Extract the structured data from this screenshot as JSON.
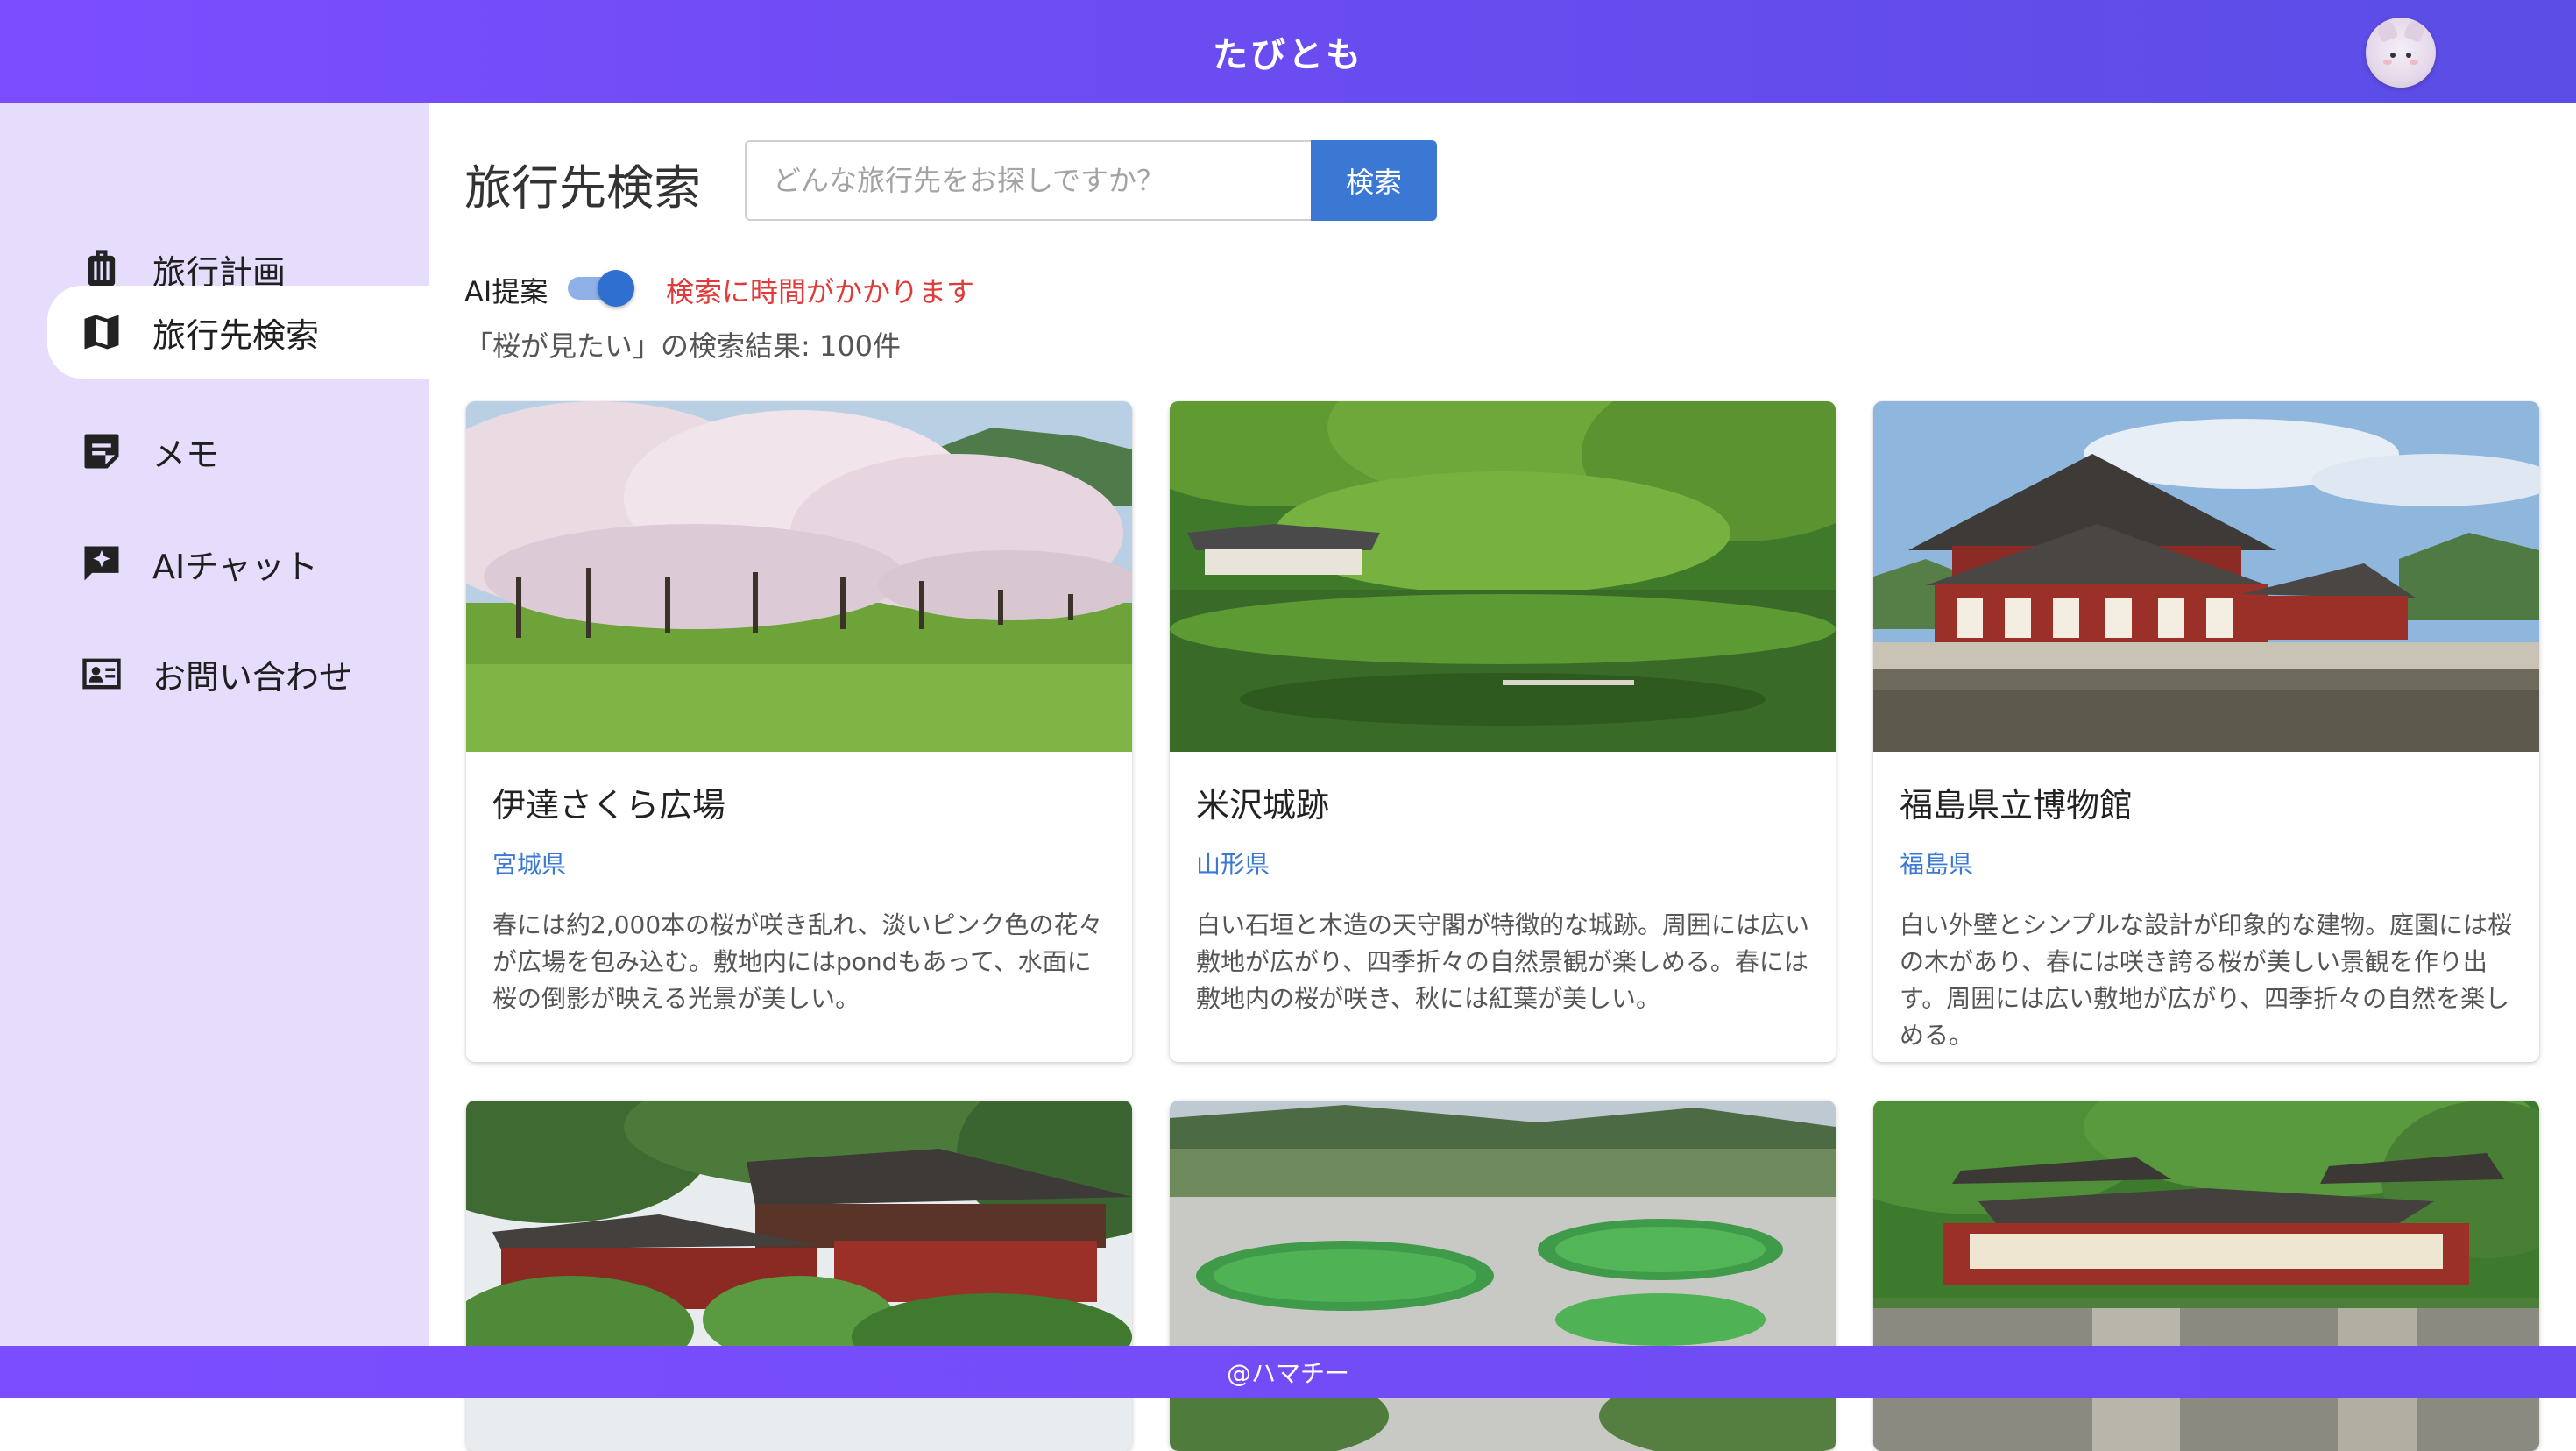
{
  "header": {
    "title": "たびとも"
  },
  "sidebar": {
    "items": [
      {
        "label": "旅行計画",
        "icon": "suitcase-icon"
      },
      {
        "label": "旅行先検索",
        "icon": "map-icon"
      },
      {
        "label": "メモ",
        "icon": "note-icon"
      },
      {
        "label": "AIチャット",
        "icon": "ai-chat-icon"
      },
      {
        "label": "お問い合わせ",
        "icon": "contact-card-icon"
      }
    ]
  },
  "search": {
    "title": "旅行先検索",
    "placeholder": "どんな旅行先をお探しですか？",
    "value": "",
    "button_label": "検索",
    "ai_label": "AI提案",
    "ai_enabled": true,
    "warning": "検索に時間がかかります",
    "result_count": "「桜が見たい」の検索結果: 100件"
  },
  "results": [
    {
      "name": "伊達さくら広場",
      "prefecture": "宮城県",
      "description": "春には約2,000本の桜が咲き乱れ、淡いピンク色の花々が広場を包み込む。敷地内にはpondもあって、水面に桜の倒影が映える光景が美しい。"
    },
    {
      "name": "米沢城跡",
      "prefecture": "山形県",
      "description": "白い石垣と木造の天守閣が特徴的な城跡。周囲には広い敷地が広がり、四季折々の自然景観が楽しめる。春には敷地内の桜が咲き、秋には紅葉が美しい。"
    },
    {
      "name": "福島県立博物館",
      "prefecture": "福島県",
      "description": "白い外壁とシンプルな設計が印象的な建物。庭園には桜の木があり、春には咲き誇る桜が美しい景観を作り出す。周囲には広い敷地が広がり、四季折々の自然を楽しめる。"
    },
    {
      "name": "",
      "prefecture": "",
      "description": ""
    },
    {
      "name": "",
      "prefecture": "",
      "description": ""
    },
    {
      "name": "",
      "prefecture": "",
      "description": ""
    }
  ],
  "footer": {
    "text": "@ハマチー"
  },
  "colors": {
    "header_gradient_start": "#7c4dff",
    "header_gradient_end": "#5b4de6",
    "sidebar_bg": "#e6dcfb",
    "accent_blue": "#3a78d4",
    "warning_red": "#e03a3a"
  }
}
